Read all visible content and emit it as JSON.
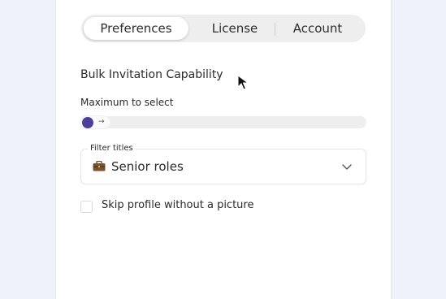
{
  "tabs": [
    {
      "label": "Preferences",
      "active": true
    },
    {
      "label": "License",
      "active": false
    },
    {
      "label": "Account",
      "active": false
    }
  ],
  "section_title": "Bulk Invitation Capability",
  "slider": {
    "label": "Maximum to select",
    "value_fraction": 0,
    "handle_icon": "arrow-right-icon",
    "accent_color": "#4b3f99"
  },
  "filter": {
    "legend": "Filter titles",
    "icon": "briefcase-icon",
    "value": "Senior roles"
  },
  "checkbox": {
    "label": "Skip profile without a picture",
    "checked": false
  },
  "colors": {
    "background": "#eef3fb",
    "panel": "#ffffff",
    "track": "#eeeeee",
    "accent": "#4b3f99"
  }
}
